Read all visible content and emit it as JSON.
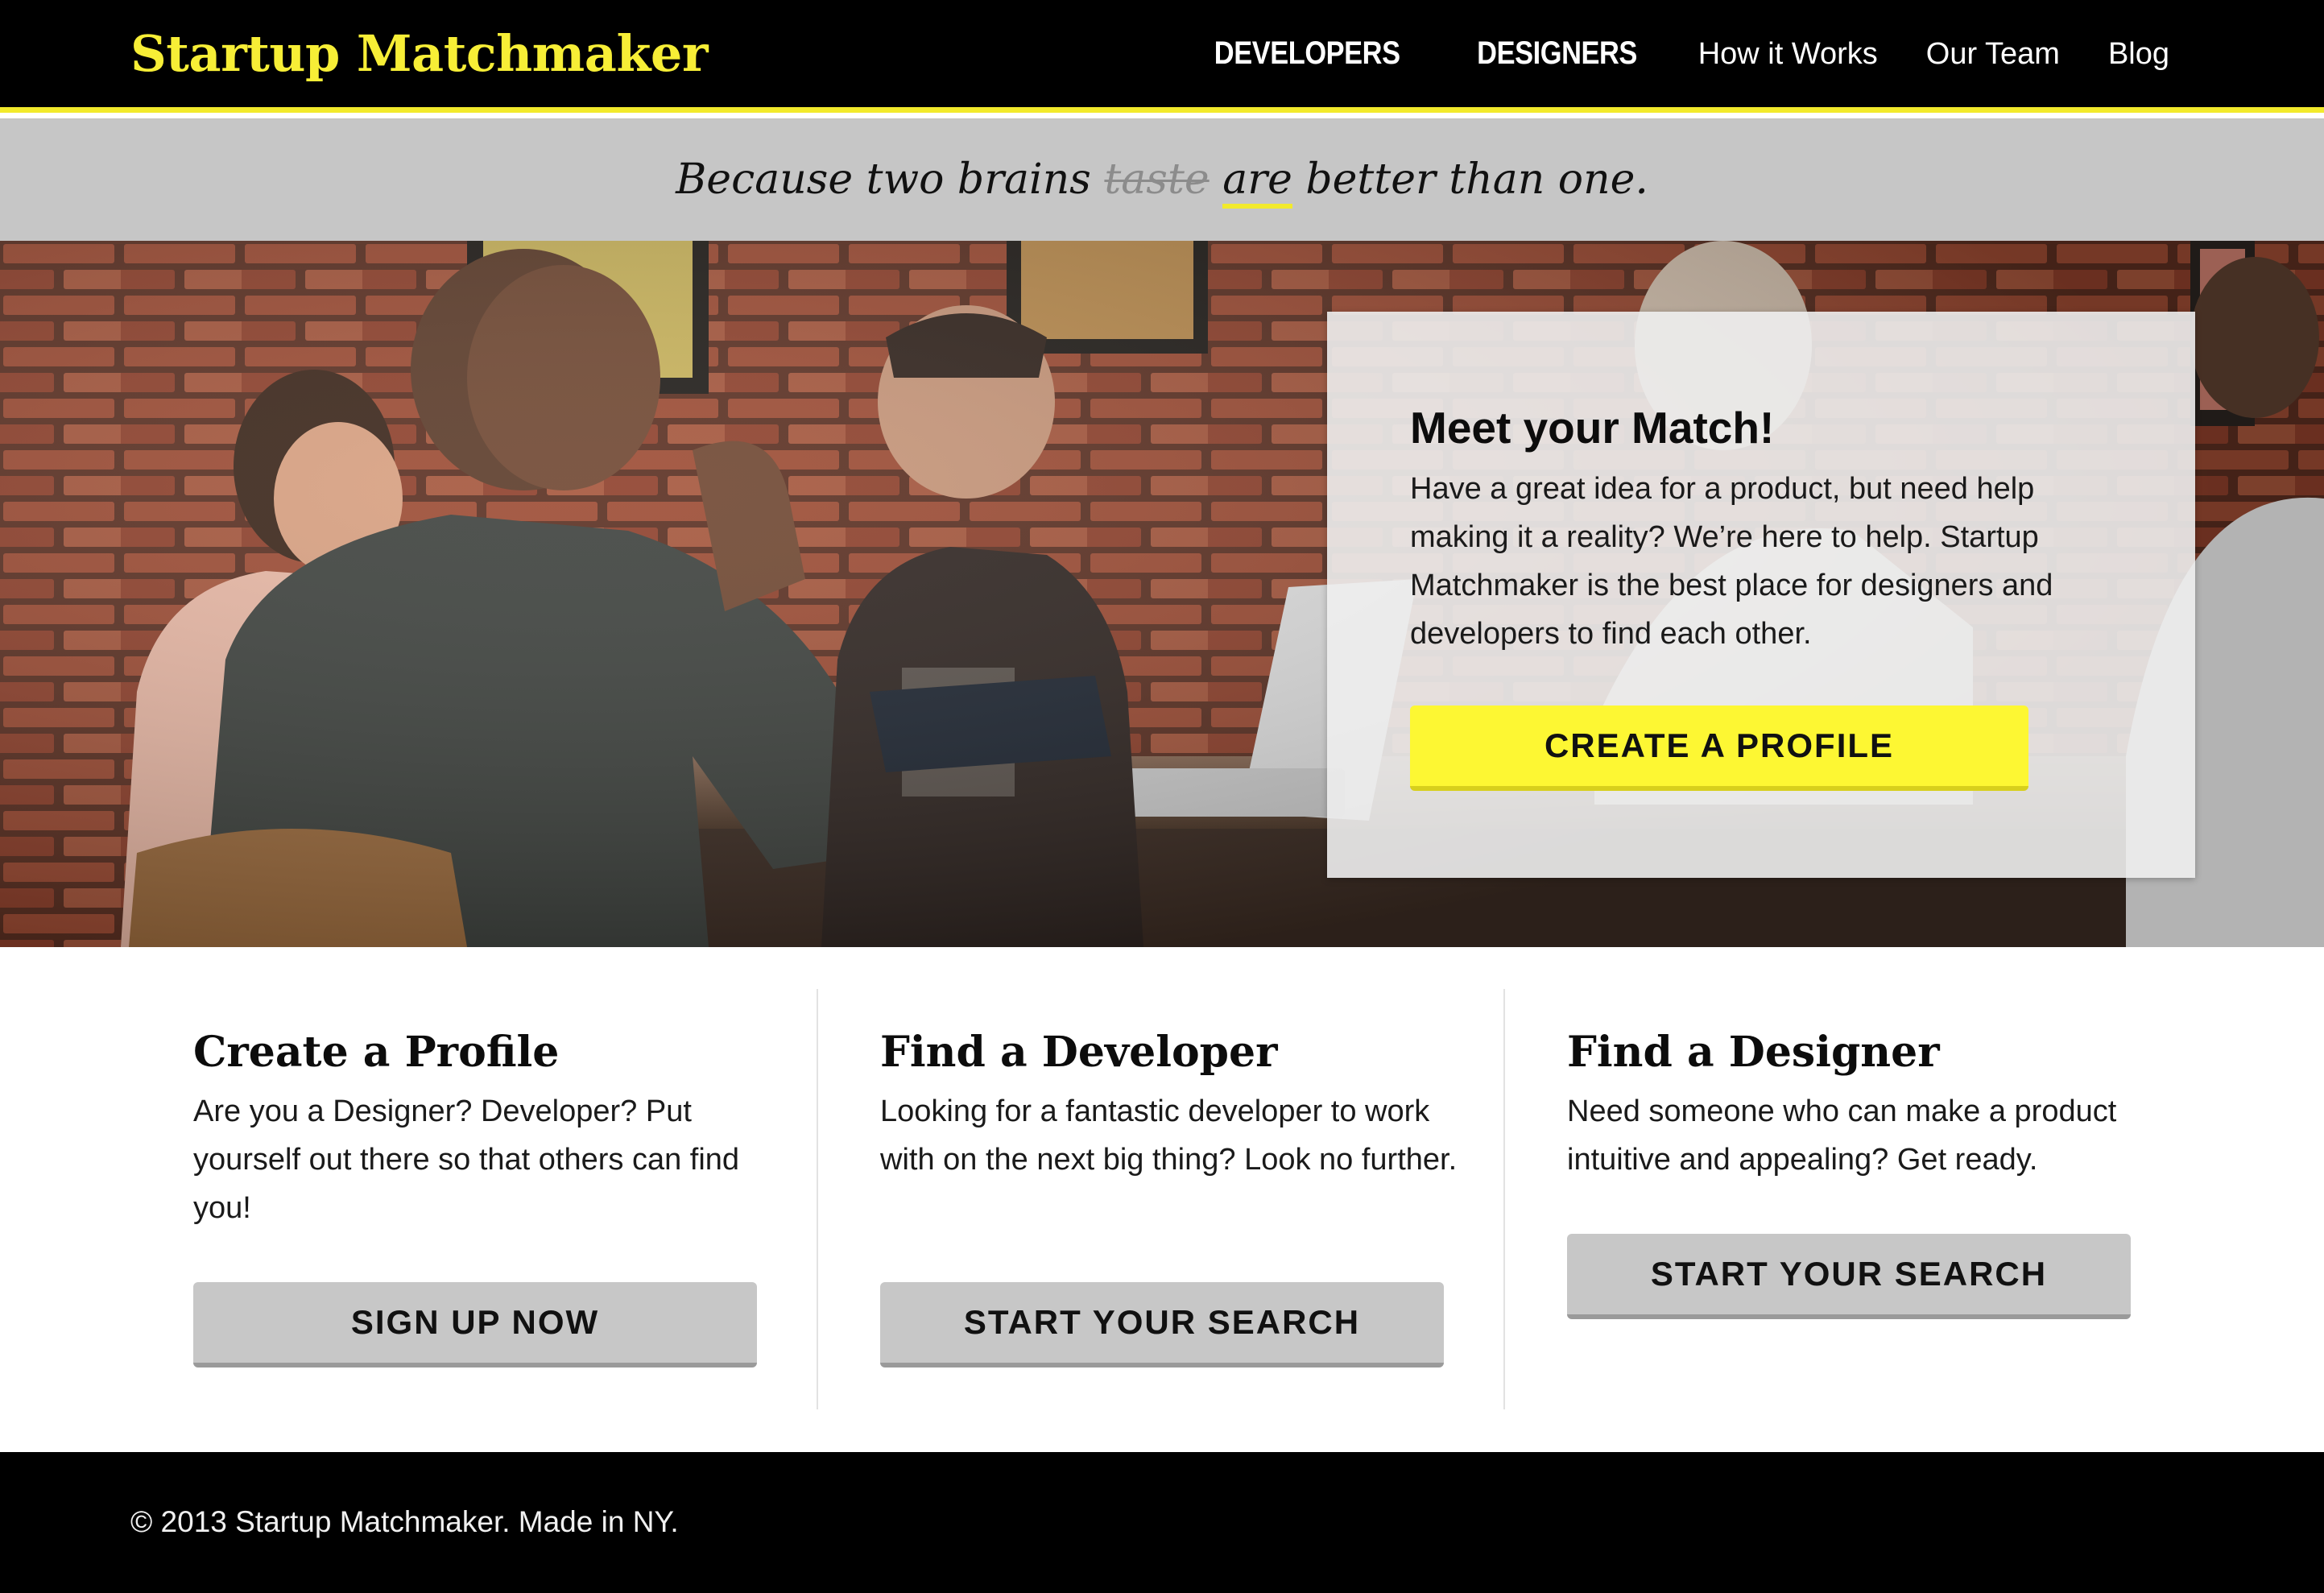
{
  "header": {
    "brand": "Startup Matchmaker",
    "nav": [
      {
        "label": "DEVELOPERS"
      },
      {
        "label": "DESIGNERS"
      },
      {
        "label": "How it Works"
      },
      {
        "label": "Our Team"
      },
      {
        "label": "Blog"
      }
    ]
  },
  "tagline": {
    "before": "Because two brains",
    "struck": "taste",
    "highlight": "are",
    "after": "better than one."
  },
  "hero": {
    "card_title": "Meet your Match!",
    "card_text": "Have a great idea for a product, but need help making it a reality? We’re here to help. Startup Matchmaker is the best place for designers and developers to find each other.",
    "cta_label": "CREATE A PROFILE"
  },
  "features": [
    {
      "title": "Create a Profile",
      "text": "Are you a Designer? Developer? Put yourself out there so that others can find you!",
      "button": "SIGN UP NOW"
    },
    {
      "title": "Find a Developer",
      "text": "Looking for a fantastic developer to work with on the next big thing? Look no further.",
      "button": "START YOUR SEARCH"
    },
    {
      "title": "Find a Designer",
      "text": "Need someone who can make a product intuitive and appealing? Get ready.",
      "button": "START YOUR SEARCH"
    }
  ],
  "footer": {
    "text": "© 2013 Startup Matchmaker. Made in NY."
  },
  "colors": {
    "accent_yellow": "#f7ee36",
    "button_yellow": "#fdf733",
    "tagline_band": "#c6c6c6",
    "button_gray": "#c7c7c7",
    "header_bg": "#000000"
  }
}
